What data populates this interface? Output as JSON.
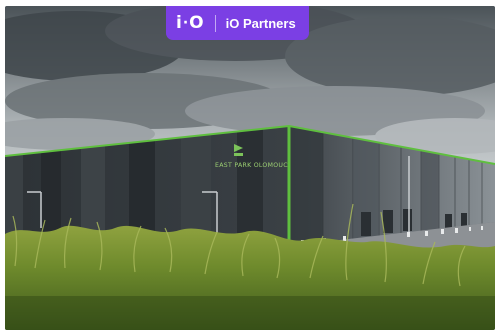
{
  "logo": {
    "mark_left": "i",
    "mark_dot": "·",
    "mark_right": "O",
    "brand_name": "iO Partners",
    "badge_color": "#7b3fe4"
  },
  "photo": {
    "building_sign": "EAST PARK OLOMOUC",
    "accent_color": "#5fbf3f"
  }
}
